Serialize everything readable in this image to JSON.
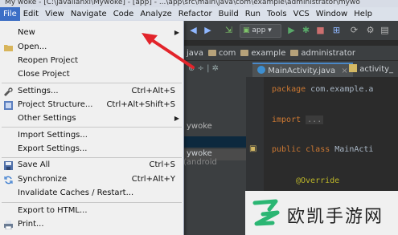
{
  "window": {
    "title": "My woke - [C:\\javalianxi\\Mywoke] - [app] - ...\\app\\src\\main\\java\\com\\example\\administrator\\mywo"
  },
  "menubar": [
    "File",
    "Edit",
    "View",
    "Navigate",
    "Code",
    "Analyze",
    "Refactor",
    "Build",
    "Run",
    "Tools",
    "VCS",
    "Window",
    "Help"
  ],
  "file_menu": {
    "new": "New",
    "open": "Open...",
    "reopen_project": "Reopen Project",
    "close_project": "Close Project",
    "settings": "Settings...",
    "settings_shortcut": "Ctrl+Alt+S",
    "project_structure": "Project Structure...",
    "project_structure_shortcut": "Ctrl+Alt+Shift+S",
    "other_settings": "Other Settings",
    "import_settings": "Import Settings...",
    "export_settings": "Export Settings...",
    "save_all": "Save All",
    "save_all_shortcut": "Ctrl+S",
    "synchronize": "Synchronize",
    "synchronize_shortcut": "Ctrl+Alt+Y",
    "invalidate_caches": "Invalidate Caches / Restart...",
    "export_html": "Export to HTML...",
    "print": "Print..."
  },
  "toolbar": {
    "run_config": "app"
  },
  "breadcrumbs": [
    "java",
    "com",
    "example",
    "administrator"
  ],
  "project_tree": {
    "item1": "ywoke",
    "item2": "ywoke",
    "item2_suffix": "(android"
  },
  "editor": {
    "tab_active": "MainActivity.java",
    "tab_other": "activity_",
    "lines": {
      "package_kw": "package",
      "package_rest": " com.example.a",
      "import_kw": "import",
      "import_fold": "...",
      "class_kw": "public class",
      "class_rest": " MainActi",
      "override": "@Override"
    }
  },
  "watermark": {
    "text": "欧凯手游网"
  }
}
